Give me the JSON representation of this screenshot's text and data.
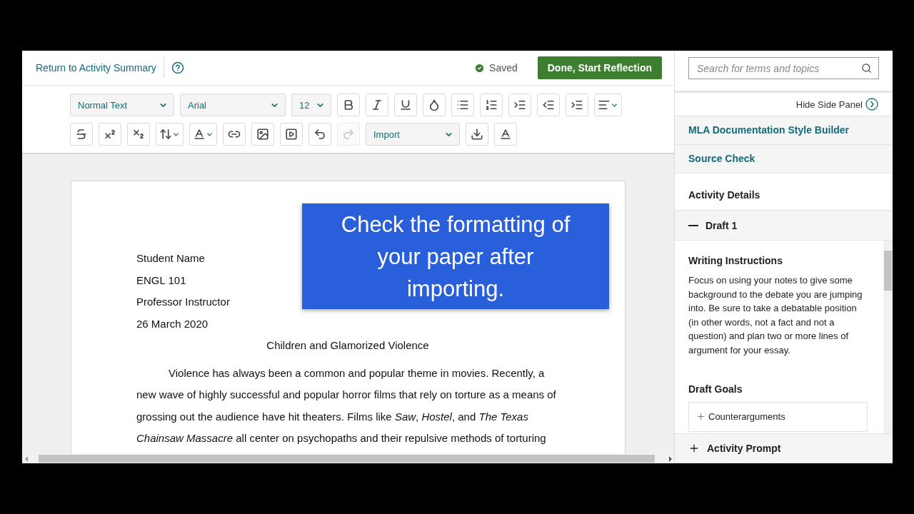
{
  "header": {
    "back_link": "Return to Activity Summary",
    "status": "Saved",
    "primary_button": "Done, Start Reflection"
  },
  "toolbar": {
    "rows": [
      [
        {
          "kind": "dropdown",
          "value": "Normal Text",
          "disabled": false
        },
        {
          "kind": "dropdown",
          "value": "Arial",
          "disabled": false
        },
        {
          "kind": "dropdown",
          "value": "12",
          "disabled": false
        },
        {
          "kind": "icon",
          "disabled": false
        },
        {
          "kind": "icon",
          "disabled": false
        },
        {
          "kind": "icon",
          "disabled": false
        },
        {
          "kind": "icon",
          "disabled": false
        },
        {
          "kind": "icon",
          "disabled": false
        },
        {
          "kind": "icon",
          "disabled": false
        },
        {
          "kind": "icon",
          "disabled": false
        },
        {
          "kind": "icon",
          "disabled": false
        },
        {
          "kind": "icon",
          "disabled": false
        },
        {
          "kind": "menu",
          "disabled": false
        }
      ],
      [
        {
          "kind": "icon",
          "disabled": false
        },
        {
          "kind": "icon",
          "disabled": false
        },
        {
          "kind": "icon",
          "disabled": false
        },
        {
          "kind": "menu",
          "disabled": false
        },
        {
          "kind": "menu",
          "disabled": false
        },
        {
          "kind": "icon",
          "disabled": false
        },
        {
          "kind": "icon",
          "disabled": false
        },
        {
          "kind": "icon",
          "disabled": false
        },
        {
          "kind": "icon",
          "disabled": false
        },
        {
          "kind": "icon",
          "disabled": true
        },
        {
          "kind": "dropdown",
          "value": "Import",
          "disabled": false
        },
        {
          "kind": "icon",
          "disabled": false
        },
        {
          "kind": "icon",
          "disabled": false
        }
      ]
    ]
  },
  "document": {
    "heading_lines": [
      "Student Name",
      "ENGL 101",
      "Professor Instructor",
      "26 March 2020"
    ],
    "title": "Children and Glamorized Violence",
    "paragraph": "Violence has always been a common and popular theme in movies. Recently, a new wave of highly successful and popular horror films that rely on torture as a means of grossing out the audience have hit theaters. Films like *Saw*, *Hostel*, and *The Texas Chainsaw Massacre* all center on psychopaths and their repulsive methods of torturing"
  },
  "callout": "Check the formatting of your paper after importing.",
  "side_panel": {
    "search": {
      "placeholder": "Search for terms and topics"
    },
    "hide_link": "Hide Side Panel",
    "links": [
      "MLA Documentation Style Builder",
      "Source Check"
    ],
    "section_title": "Activity Details",
    "draft": {
      "label": "Draft 1",
      "expanded": true,
      "instructions_title": "Writing Instructions",
      "instructions": "Focus on using your notes to give some background to the debate you are jumping into. Be sure to take a debatable position (in other words, not a fact and not a question) and plan two or more lines of argument for your essay.",
      "goals_title": "Draft Goals",
      "goals": [
        {
          "label": "Counterarguments",
          "expanded": false
        }
      ]
    },
    "prompt": {
      "label": "Activity Prompt",
      "expanded": false
    }
  }
}
